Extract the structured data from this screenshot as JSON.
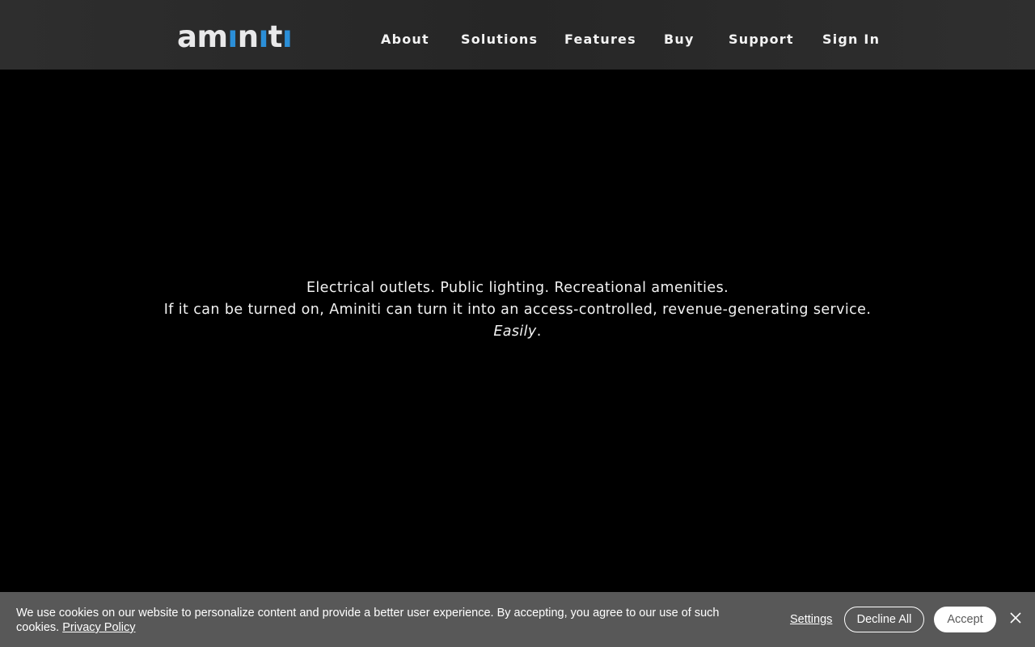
{
  "header": {
    "logo": {
      "letters": [
        "a",
        "m",
        "ı",
        "n",
        "ı",
        "t",
        "ı"
      ],
      "text": "aminiti",
      "colors": {
        "white": "#e9e9ea",
        "blue": "#2b8fd8"
      }
    },
    "nav": [
      {
        "label": "About"
      },
      {
        "label": "Solutions"
      },
      {
        "label": "Features"
      },
      {
        "label": "Buy"
      },
      {
        "label": "Support"
      },
      {
        "label": "Sign In"
      }
    ]
  },
  "hero": {
    "line1": "Electrical outlets. Public lighting. Recreational amenities.",
    "line2": "If it can be turned on, Aminiti can turn it into an access-controlled, revenue-generating service.",
    "line3_italic": "Easily",
    "line3_suffix": "."
  },
  "cookie_banner": {
    "message": "We use cookies on our website to personalize content and provide a better user experience. By accepting, you agree to our use of such cookies. ",
    "privacy_link": "Privacy Policy",
    "settings_label": "Settings",
    "decline_label": "Decline All",
    "accept_label": "Accept",
    "close_icon": "close-icon"
  },
  "colors": {
    "header_bg": "#2a2a2a",
    "hero_bg": "#000000",
    "cookie_bg": "#585858",
    "accent_blue": "#2b8fd8"
  }
}
